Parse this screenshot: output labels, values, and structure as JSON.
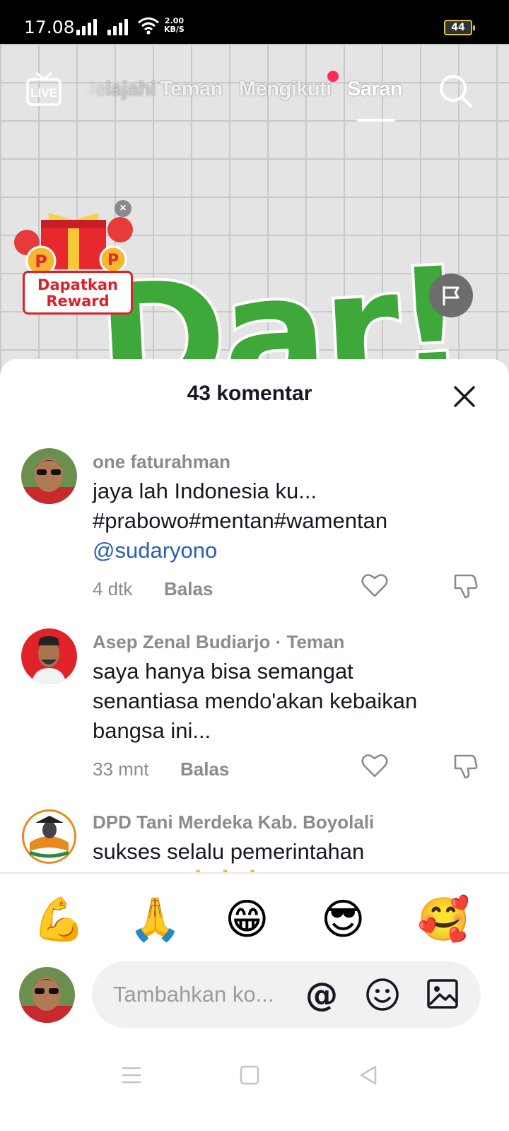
{
  "status_bar": {
    "time": "17.08",
    "net_speed_value": "2.00",
    "net_speed_unit": "KB/S",
    "battery": "44"
  },
  "top_nav": {
    "tabs": [
      "Jelajahi",
      "Teman",
      "Mengikuti",
      "Saran"
    ],
    "live_label": "LIVE"
  },
  "video": {
    "big_text": "Dar!"
  },
  "reward": {
    "line1": "Dapatkan",
    "line2": "Reward"
  },
  "comments_sheet": {
    "title": "43 komentar",
    "comments": [
      {
        "author": "one faturahman",
        "text_line1": "jaya lah Indonesia ku...",
        "text_line2": "#prabowo#mentan#wamentan",
        "mention": "@sudaryono",
        "time": "4 dtk",
        "reply": "Balas"
      },
      {
        "author": "Asep Zenal Budiarjo · Teman",
        "text_line1": "saya hanya bisa semangat",
        "text_line2": "senantiasa mendo'akan kebaikan",
        "text_line3": "bangsa ini...",
        "time": "33 mnt",
        "reply": "Balas"
      },
      {
        "author": "DPD Tani Merdeka Kab. Boyolali",
        "text_line1": "sukses selalu pemerintahan",
        "text_line2": "prabowo 👍👍👍"
      }
    ],
    "quick_emojis": [
      "💪",
      "🙏",
      "😁",
      "😎",
      "🥰"
    ],
    "input": {
      "placeholder": "Tambahkan ko..."
    }
  },
  "icons": [
    "live-icon",
    "search-icon",
    "flag-icon",
    "close-icon",
    "heart-icon",
    "thumbs-down-icon",
    "at-icon",
    "emoji-icon",
    "image-icon",
    "menu-icon",
    "home-icon",
    "back-icon"
  ],
  "colors": {
    "accent": "#fe2c55",
    "mention": "#2b5db9",
    "reward_red": "#d8232a",
    "video_green": "#3fa83a"
  }
}
